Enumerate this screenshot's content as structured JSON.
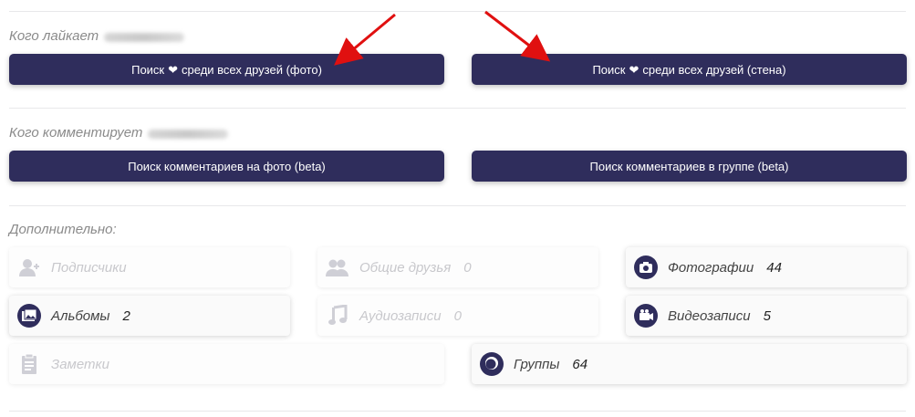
{
  "likes": {
    "label": "Кого лайкает",
    "btn_photo_pre": "Поиск",
    "btn_photo_post": "среди всех друзей (фото)",
    "btn_wall_pre": "Поиск",
    "btn_wall_post": "среди всех друзей (стена)"
  },
  "comments": {
    "label": "Кого комментирует",
    "btn_photo": "Поиск комментариев на фото (beta)",
    "btn_group": "Поиск комментариев в группе (beta)"
  },
  "extra": {
    "label": "Дополнительно:",
    "tiles": [
      {
        "label": "Подписчики",
        "count": "",
        "icon": "add-user-icon",
        "enabled": false
      },
      {
        "label": "Общие друзья",
        "count": "0",
        "icon": "friends-icon",
        "enabled": false
      },
      {
        "label": "Фотографии",
        "count": "44",
        "icon": "camera-icon",
        "enabled": true
      },
      {
        "label": "Альбомы",
        "count": "2",
        "icon": "albums-icon",
        "enabled": true
      },
      {
        "label": "Аудиозаписи",
        "count": "0",
        "icon": "music-note-icon",
        "enabled": false
      },
      {
        "label": "Видеозаписи",
        "count": "5",
        "icon": "video-camera-icon",
        "enabled": true
      },
      {
        "label": "Заметки",
        "count": "",
        "icon": "notes-icon",
        "enabled": false
      },
      {
        "label": "Группы",
        "count": "64",
        "icon": "groups-icon",
        "enabled": true
      }
    ]
  },
  "colors": {
    "button_bg": "#2f2d5c",
    "icon_active": "#2f2d5c",
    "icon_disabled": "#cfcfd6",
    "arrow": "#e01010"
  }
}
